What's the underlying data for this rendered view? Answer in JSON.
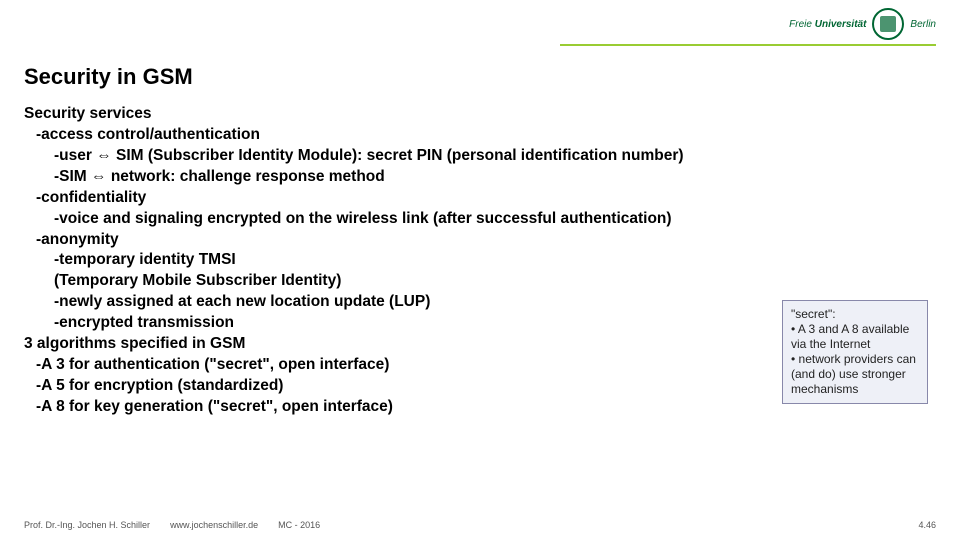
{
  "logo": {
    "word1": "Freie",
    "word2": "Universität",
    "city": "Berlin"
  },
  "title": "Security in GSM",
  "lines": [
    {
      "cls": "l0",
      "text": "Security services"
    },
    {
      "cls": "l1",
      "text": "-access control/authentication"
    },
    {
      "cls": "l2",
      "text": "-user ⇔ SIM (Subscriber Identity Module): secret PIN (personal identification number)"
    },
    {
      "cls": "l2",
      "text": "-SIM ⇔ network: challenge response method"
    },
    {
      "cls": "l1",
      "text": "-confidentiality"
    },
    {
      "cls": "l2",
      "text": "-voice and signaling encrypted on the wireless link (after successful authentication)"
    },
    {
      "cls": "l1",
      "text": "-anonymity"
    },
    {
      "cls": "l2",
      "text": "-temporary identity TMSI"
    },
    {
      "cls": "l2",
      "text": " (Temporary Mobile Subscriber Identity)"
    },
    {
      "cls": "l2",
      "text": "-newly assigned at each new location update (LUP)"
    },
    {
      "cls": "l2",
      "text": "-encrypted transmission"
    },
    {
      "cls": "l0",
      "text": "3 algorithms specified in GSM"
    },
    {
      "cls": "l1",
      "text": "-A 3 for authentication (\"secret\", open interface)"
    },
    {
      "cls": "l1",
      "text": "-A 5 for encryption (standardized)"
    },
    {
      "cls": "l1",
      "text": "-A 8 for key generation (\"secret\", open interface)"
    }
  ],
  "note": {
    "l1": "\"secret\":",
    "l2": "• A 3 and A 8 available via the Internet",
    "l3": "• network providers can (and do) use stronger mechanisms"
  },
  "footer": {
    "author": "Prof. Dr.-Ing. Jochen H. Schiller",
    "url": "www.jochenschiller.de",
    "course": "MC - 2016",
    "page": "4.46"
  }
}
